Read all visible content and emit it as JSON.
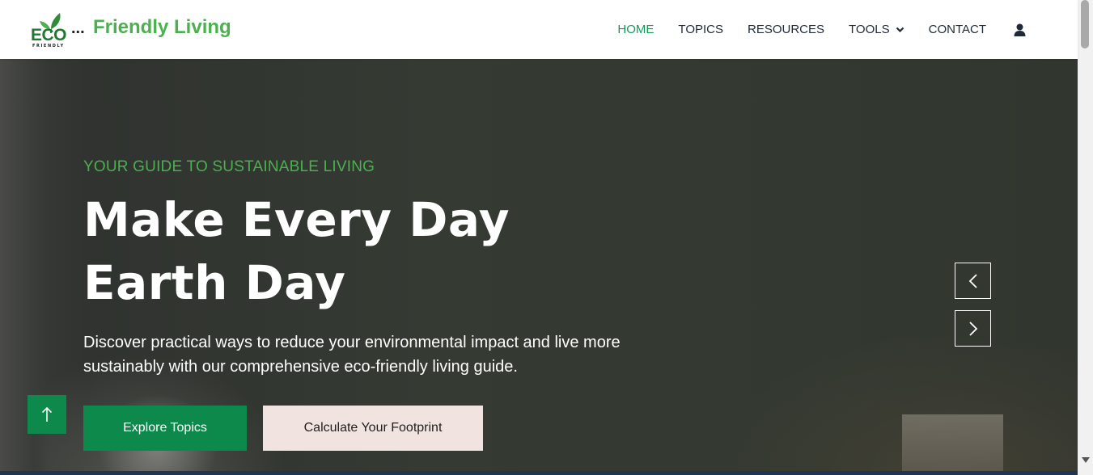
{
  "brand": {
    "logo_text": "ECO",
    "logo_subtext": "FRIENDLY",
    "dots": "...",
    "name": "Friendly Living"
  },
  "nav": {
    "items": [
      {
        "label": "HOME",
        "active": true
      },
      {
        "label": "TOPICS",
        "active": false
      },
      {
        "label": "RESOURCES",
        "active": false
      },
      {
        "label": "TOOLS",
        "active": false,
        "has_dropdown": true
      },
      {
        "label": "CONTACT",
        "active": false
      }
    ],
    "user_icon": "user-icon"
  },
  "hero": {
    "eyebrow": "YOUR GUIDE TO SUSTAINABLE LIVING",
    "headline": "Make Every Day Earth Day",
    "subtext": "Discover practical ways to reduce your environmental impact and live more sustainably with our comprehensive eco-friendly living guide.",
    "primary_button": "Explore Topics",
    "secondary_button": "Calculate Your Footprint",
    "prev_icon": "chevron-left-icon",
    "next_icon": "chevron-right-icon"
  },
  "back_to_top_icon": "arrow-up-icon",
  "colors": {
    "accent_green": "#4caf50",
    "primary_button": "#0d8a4b",
    "secondary_button": "#f1e4e0",
    "nav_active": "#18985a",
    "nav_text": "#1f2a37"
  }
}
